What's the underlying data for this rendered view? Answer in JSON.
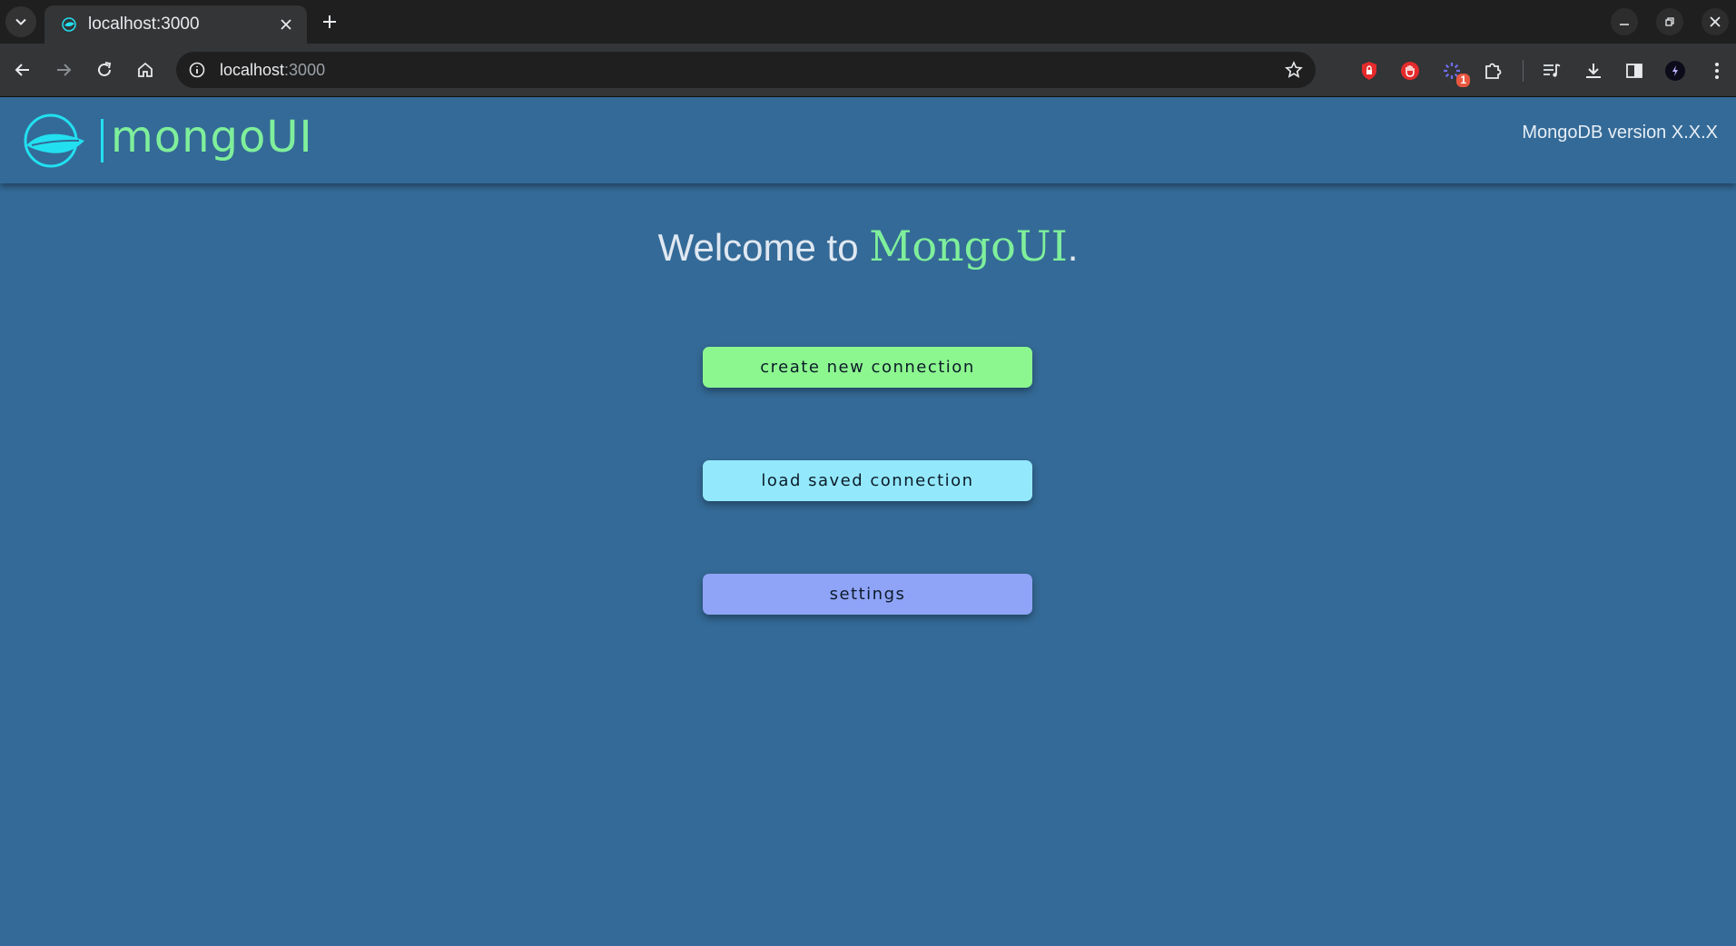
{
  "browser": {
    "tab": {
      "title": "localhost:3000"
    },
    "address": {
      "host": "localhost",
      "port": ":3000"
    },
    "extensions": [
      {
        "icon": "lock-shield-icon",
        "color": "#e52b2b"
      },
      {
        "icon": "hand-stop-icon",
        "color": "#e52b2b"
      },
      {
        "icon": "spinner-ext-icon",
        "color": "#6f6ff0",
        "badge": "1"
      },
      {
        "icon": "puzzle-icon"
      }
    ]
  },
  "header": {
    "logo_text": "mongoUI",
    "version_text": "MongoDB version X.X.X"
  },
  "main": {
    "welcome_prefix": "Welcome to ",
    "welcome_brand": "MongoUI",
    "welcome_suffix": ".",
    "buttons": {
      "create": "create new connection",
      "load": "load saved connection",
      "settings": "settings"
    }
  },
  "colors": {
    "background": "#346a97",
    "brand_green": "#7fef9b",
    "create_button": "#8cf78f",
    "load_button": "#93e9fb",
    "settings_button": "#8fa4f7"
  }
}
